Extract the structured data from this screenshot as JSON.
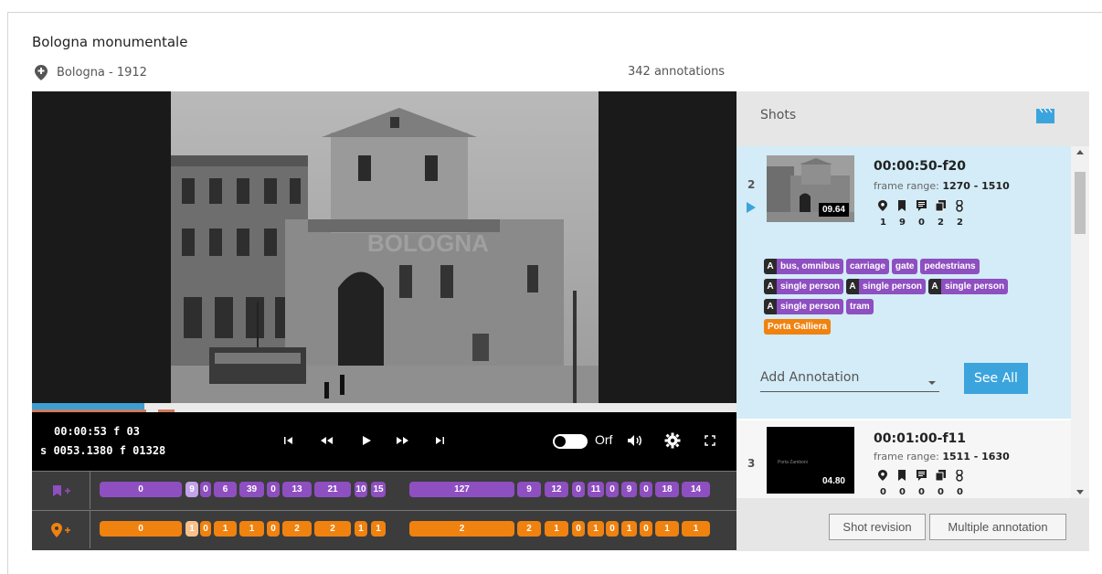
{
  "title": "Bologna monumentale",
  "location": "Bologna - 1912",
  "annotation_count": "342 annotations",
  "player": {
    "timecode": "00:00:53  f 03",
    "frame_info": "s 0053.1380 f 01328",
    "orf_label": "Orf",
    "played_percent": 16,
    "buffered_percent": 100
  },
  "tracks": {
    "tag_track": {
      "icon": "bookmark-plus-icon",
      "color": "#8e4fc1",
      "segments": [
        "0",
        "9",
        "0",
        "6",
        "39",
        "0",
        "13",
        "21",
        "10",
        "15",
        "127",
        "9",
        "12",
        "0",
        "11",
        "0",
        "9",
        "0",
        "18",
        "14"
      ]
    },
    "location_track": {
      "icon": "pin-plus-icon",
      "color": "#f0820f",
      "segments": [
        "0",
        "1",
        "0",
        "1",
        "1",
        "0",
        "2",
        "2",
        "1",
        "1",
        "2",
        "2",
        "1",
        "0",
        "1",
        "0",
        "1",
        "0",
        "1",
        "1"
      ]
    }
  },
  "shots_panel": {
    "title": "Shots",
    "active_shot": {
      "number": "2",
      "thumb_badge": "09.64",
      "timecode": "00:00:50-f20",
      "range_label": "frame range: ",
      "range_value": "1270 - 1510",
      "stats": [
        "1",
        "9",
        "0",
        "2",
        "2"
      ],
      "tag_lines": [
        [
          {
            "label": "bus, omnibus",
            "a": true
          },
          {
            "label": "carriage",
            "a": false
          },
          {
            "label": "gate",
            "a": false
          },
          {
            "label": "pedestrians",
            "a": false
          }
        ],
        [
          {
            "label": "single person",
            "a": true
          },
          {
            "label": "single person",
            "a": true
          },
          {
            "label": "single person",
            "a": true
          }
        ],
        [
          {
            "label": "single person",
            "a": true
          },
          {
            "label": "tram",
            "a": false
          }
        ]
      ],
      "location_tag": "Porta Galliera",
      "add_annotation_label": "Add Annotation",
      "see_all_label": "See All"
    },
    "next_shot": {
      "number": "3",
      "thumb_caption": "Porta Zamboni",
      "thumb_badge": "04.80",
      "timecode": "00:01:00-f11",
      "range_label": "frame range: ",
      "range_value": "1511 - 1630",
      "stats": [
        "0",
        "0",
        "0",
        "0",
        "0"
      ]
    },
    "shot_revision_label": "Shot revision",
    "multiple_annotation_label": "Multiple annotation"
  },
  "colors": {
    "accent_blue": "#3ca4dc",
    "tag_purple": "#8e4fc1",
    "location_orange": "#f0820f",
    "active_shot_bg": "#d3ecf7"
  }
}
